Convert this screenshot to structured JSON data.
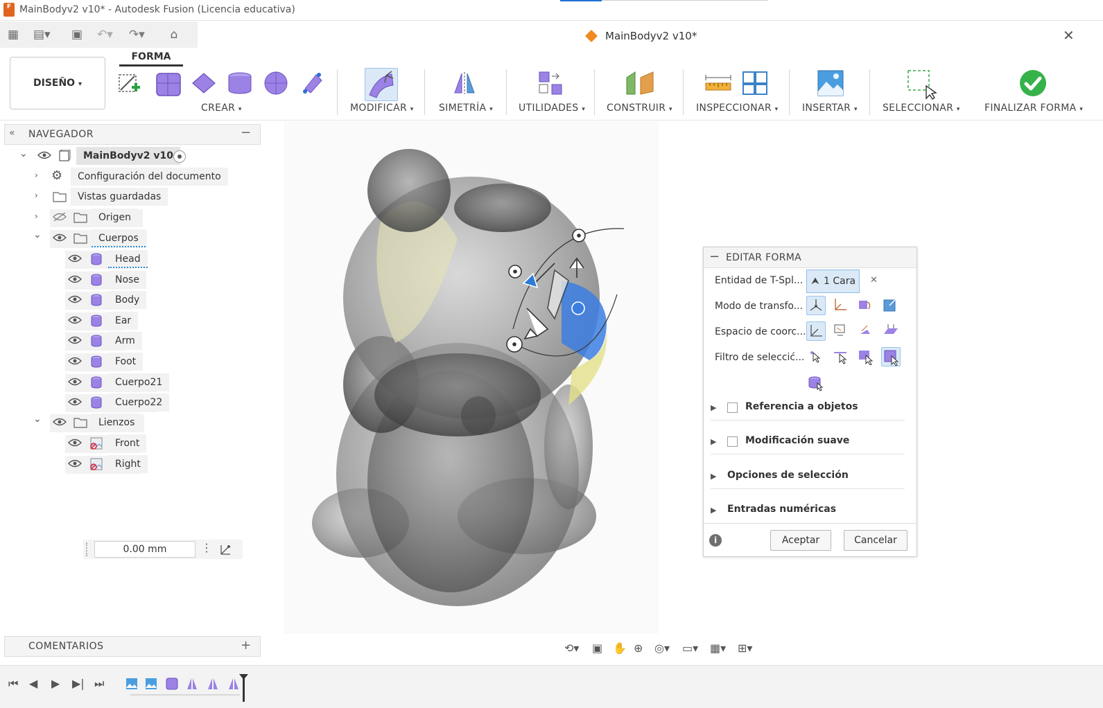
{
  "app": {
    "window_title": "MainBodyv2 v10* - Autodesk Fusion (Licencia educativa)",
    "logo_text": "F",
    "document_tab": "MainBodyv2 v10*"
  },
  "ribbon": {
    "workspace": "DISEÑO",
    "active_tab": "FORMA",
    "groups": {
      "crear": "CREAR",
      "modificar": "MODIFICAR",
      "simetria": "SIMETRÍA",
      "utilidades": "UTILIDADES",
      "construir": "CONSTRUIR",
      "inspeccionar": "INSPECCIONAR",
      "insertar": "INSERTAR",
      "seleccionar": "SELECCIONAR",
      "finalizar": "FINALIZAR FORMA"
    },
    "colors": {
      "form_purple": "#8b6fd6",
      "finish_green": "#35b24a",
      "accent_blue": "#1f6fd1"
    }
  },
  "navigator": {
    "title": "NAVEGADOR",
    "root": "MainBodyv2 v10",
    "items": [
      {
        "label": "Configuración del documento"
      },
      {
        "label": "Vistas guardadas"
      },
      {
        "label": "Origen"
      },
      {
        "label": "Cuerpos"
      }
    ],
    "bodies": [
      "Head",
      "Nose",
      "Body",
      "Ear",
      "Arm",
      "Foot",
      "Cuerpo21",
      "Cuerpo22"
    ],
    "canvases_label": "Lienzos",
    "canvases": [
      "Front",
      "Right"
    ]
  },
  "measure_input": "0.00 mm",
  "comments_title": "COMENTARIOS",
  "dialog": {
    "title": "EDITAR FORMA",
    "entity_label": "Entidad de T-Spl...",
    "entity_value": "1 Cara",
    "transform_label": "Modo de transfo...",
    "coord_label": "Espacio de coorc...",
    "filter_label": "Filtro de seleccić...",
    "sections": {
      "ref": "Referencia a objetos",
      "soft": "Modificación suave",
      "opts": "Opciones de selección",
      "num": "Entradas numéricas"
    },
    "ok": "Aceptar",
    "cancel": "Cancelar"
  }
}
